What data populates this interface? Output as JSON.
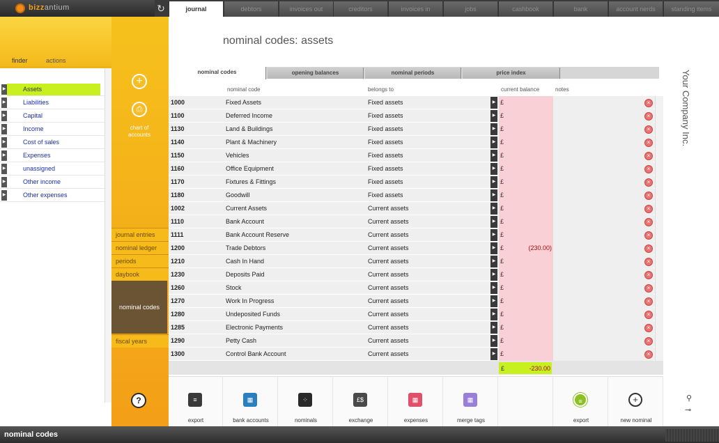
{
  "app": {
    "logo_prefix": "bizz",
    "logo_suffix": "antium"
  },
  "nav_tabs": [
    {
      "label": "journal",
      "active": true
    },
    {
      "label": "debtors"
    },
    {
      "label": "invoices out"
    },
    {
      "label": "creditors"
    },
    {
      "label": "invoices in"
    },
    {
      "label": "jobs"
    },
    {
      "label": "cashbook"
    },
    {
      "label": "bank"
    },
    {
      "label": "account nerds"
    },
    {
      "label": "standing items"
    }
  ],
  "finder": {
    "tab_finder": "finder",
    "tab_actions": "actions",
    "items": [
      "Assets",
      "Liabilities",
      "Capital",
      "Income",
      "Cost of sales",
      "Expenses",
      "unassigned",
      "Other income",
      "Other expenses"
    ],
    "selected": "Assets"
  },
  "middle": {
    "chart_of_accounts": "chart of accounts",
    "links": [
      "journal entries",
      "nominal ledger",
      "periods",
      "daybook"
    ],
    "selected": "nominal codes",
    "after": "fiscal years"
  },
  "page": {
    "title": "nominal codes: assets",
    "company": "Your Company Inc."
  },
  "subtabs": [
    "nominal codes",
    "opening balances",
    "nominal periods",
    "price index"
  ],
  "columns": {
    "code": "nominal code",
    "belongs": "belongs to",
    "balance": "current balance",
    "notes": "notes"
  },
  "rows": [
    {
      "code": "1000",
      "name": "Fixed Assets",
      "belongs": "Fixed assets",
      "amount": ""
    },
    {
      "code": "1100",
      "name": "Deferred Income",
      "belongs": "Fixed assets",
      "amount": ""
    },
    {
      "code": "1130",
      "name": "Land & Buildings",
      "belongs": "Fixed assets",
      "amount": ""
    },
    {
      "code": "1140",
      "name": "Plant & Machinery",
      "belongs": "Fixed assets",
      "amount": ""
    },
    {
      "code": "1150",
      "name": "Vehicles",
      "belongs": "Fixed assets",
      "amount": ""
    },
    {
      "code": "1160",
      "name": "Office Equipment",
      "belongs": "Fixed assets",
      "amount": ""
    },
    {
      "code": "1170",
      "name": "Fixtures & Fittings",
      "belongs": "Fixed assets",
      "amount": ""
    },
    {
      "code": "1180",
      "name": "Goodwill",
      "belongs": "Fixed assets",
      "amount": ""
    },
    {
      "code": "1002",
      "name": "Current Assets",
      "belongs": "Current assets",
      "amount": ""
    },
    {
      "code": "1110",
      "name": "Bank Account",
      "belongs": "Current assets",
      "amount": ""
    },
    {
      "code": "1111",
      "name": "Bank Account Reserve",
      "belongs": "Current assets",
      "amount": ""
    },
    {
      "code": "1200",
      "name": "Trade Debtors",
      "belongs": "Current assets",
      "amount": "(230.00)"
    },
    {
      "code": "1210",
      "name": "Cash In Hand",
      "belongs": "Current assets",
      "amount": ""
    },
    {
      "code": "1230",
      "name": "Deposits Paid",
      "belongs": "Current assets",
      "amount": ""
    },
    {
      "code": "1260",
      "name": "Stock",
      "belongs": "Current assets",
      "amount": ""
    },
    {
      "code": "1270",
      "name": "Work In Progress",
      "belongs": "Current assets",
      "amount": ""
    },
    {
      "code": "1280",
      "name": "Undeposited Funds",
      "belongs": "Current assets",
      "amount": ""
    },
    {
      "code": "1285",
      "name": "Electronic Payments",
      "belongs": "Current assets",
      "amount": ""
    },
    {
      "code": "1290",
      "name": "Petty Cash",
      "belongs": "Current assets",
      "amount": ""
    },
    {
      "code": "1300",
      "name": "Control Bank Account",
      "belongs": "Current assets",
      "amount": ""
    }
  ],
  "currency": "£",
  "total": "-230.00",
  "toolbar": [
    {
      "label": "export",
      "icon": "list-icon",
      "color": "#3a3a3a",
      "glyph": "≡"
    },
    {
      "label": "bank accounts",
      "icon": "grid-icon",
      "color": "#2a7fbf",
      "glyph": "▦"
    },
    {
      "label": "nominals",
      "icon": "dots-icon",
      "color": "#2a2a2a",
      "glyph": "⁘"
    },
    {
      "label": "exchange",
      "icon": "currency-icon",
      "color": "#4a4a4a",
      "glyph": "£$"
    },
    {
      "label": "expenses",
      "icon": "grid-icon",
      "color": "#e0506a",
      "glyph": "▦"
    },
    {
      "label": "merge tags",
      "icon": "grid-icon",
      "color": "#9a7fd8",
      "glyph": "▦"
    },
    {
      "label": "",
      "icon": "",
      "color": "",
      "glyph": ""
    },
    {
      "label": "export",
      "icon": "list-circle-icon",
      "color": "#8ac020",
      "glyph": "≡"
    },
    {
      "label": "new nominal",
      "icon": "plus-icon",
      "color": "#333",
      "glyph": "+"
    }
  ],
  "statusbar": {
    "text": "nominal codes"
  }
}
